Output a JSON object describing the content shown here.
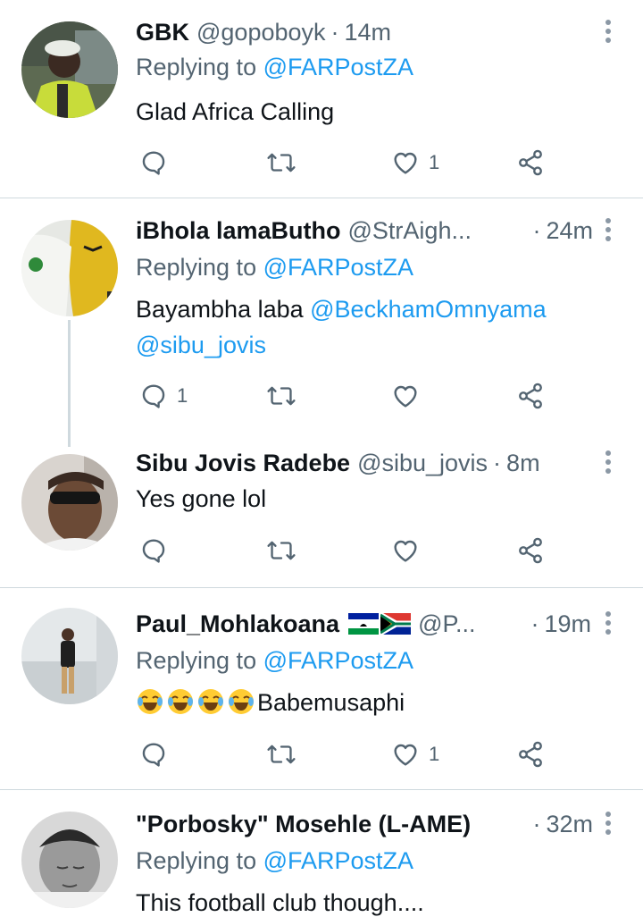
{
  "tweets": [
    {
      "name": "GBK",
      "handle": "@gopoboyk",
      "time": "14m",
      "replying_prefix": "Replying to ",
      "replying_to": "@FARPostZA",
      "text": "Glad Africa Calling",
      "reply_count": "",
      "retweet_count": "",
      "like_count": "1"
    },
    {
      "name": "iBhola lamaButho",
      "handle": "@StrAigh...",
      "time": "24m",
      "replying_prefix": "Replying to ",
      "replying_to": "@FARPostZA",
      "text_prefix": "Bayambha laba ",
      "mention_1": "@BeckhamOmnyama",
      "mention_2": "@sibu_jovis",
      "reply_count": "1",
      "retweet_count": "",
      "like_count": ""
    },
    {
      "name": "Sibu Jovis Radebe",
      "handle": "@sibu_jovis",
      "time": "8m",
      "text": "Yes gone lol",
      "reply_count": "",
      "retweet_count": "",
      "like_count": ""
    },
    {
      "name": "Paul_Mohlakoana",
      "handle": "@P...",
      "time": "19m",
      "replying_prefix": "Replying to ",
      "replying_to": "@FARPostZA",
      "text": "Babemusaphi",
      "reply_count": "",
      "retweet_count": "",
      "like_count": "1"
    },
    {
      "name": "\"Porbosky\" Mosehle (L-AME)",
      "time": "32m",
      "replying_prefix": "Replying to ",
      "replying_to": "@FARPostZA",
      "text": "This football club though...."
    }
  ],
  "separator": "·",
  "icons": {
    "reply": "reply-icon",
    "retweet": "retweet-icon",
    "like": "heart-icon",
    "share": "share-icon",
    "more": "more-vertical-icon",
    "emoji": "face-with-tears-of-joy"
  },
  "colors": {
    "text": "#0f1419",
    "secondary": "#536471",
    "link": "#1d9bf0",
    "divider": "#cfd9de"
  }
}
